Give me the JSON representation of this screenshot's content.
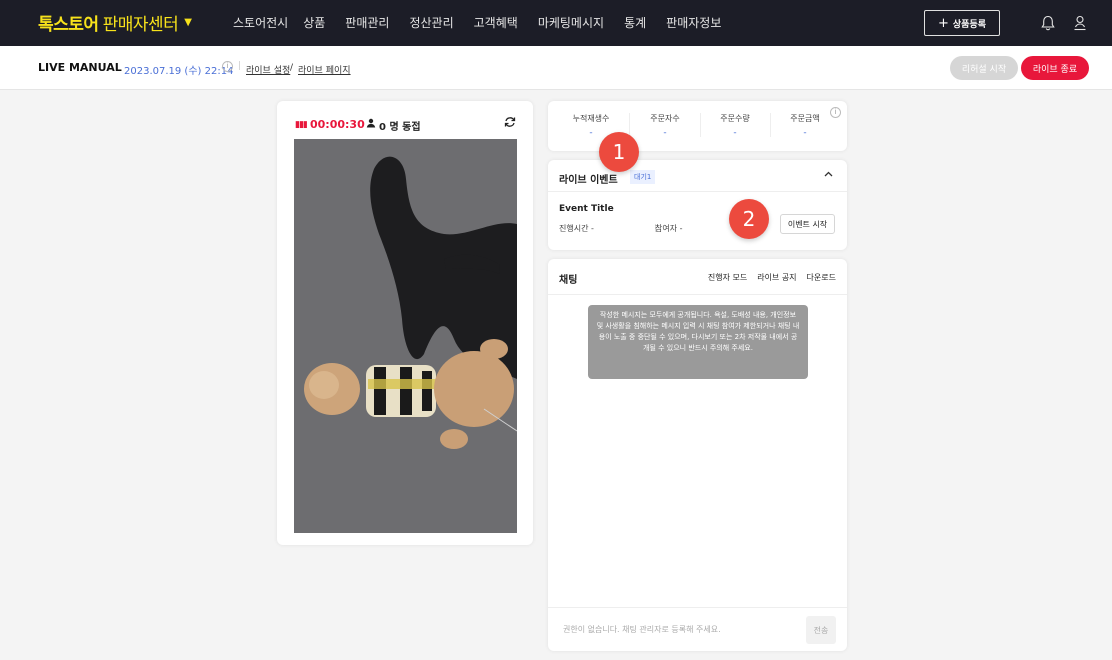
{
  "header": {
    "brand_name": "톡스토어",
    "brand_sub": "판매자센터",
    "menu": [
      "스토어전시",
      "상품",
      "판매관리",
      "정산관리",
      "고객혜택",
      "마케팅메시지",
      "통계",
      "판매자정보"
    ],
    "add_product_label": "상품등록",
    "icons": [
      "bell-icon",
      "user-icon"
    ]
  },
  "subheader": {
    "title": "LIVE MANUAL",
    "datetime": "2023.07.19 (수) 22:14",
    "link_settings": "라이브 설정",
    "link_separator": "/",
    "link_page": "라이브 페이지",
    "rehearsal_label": "리허설 시작",
    "end_label": "라이브 종료"
  },
  "video": {
    "timer": "00:00:30",
    "viewers": "0 명 동접"
  },
  "stats": [
    {
      "label": "누적재생수",
      "value": "-"
    },
    {
      "label": "주문자수",
      "value": "-"
    },
    {
      "label": "주문수량",
      "value": "-"
    },
    {
      "label": "주문금액",
      "value": "-"
    }
  ],
  "event": {
    "title": "라이브 이벤트",
    "status": "대기1",
    "name": "Event Title",
    "duration_label": "진행시간 -",
    "participants_label": "참여자 -",
    "start_label": "이벤트 시작"
  },
  "chat": {
    "title": "채팅",
    "tabs": [
      "진행자 모드",
      "라이브 공지",
      "다운로드"
    ],
    "notice": "작성한 메시지는 모두에게 공개됩니다. 욕설, 도배성 내용, 개인정보 및 사생활을 침해하는 메시지 입력 시 채팅 참여가 제한되거나 채팅 내용이 노출 중 중단될 수 있으며, 다시보기 또는 2차 저작물 내에서 공개될 수 있으니 반드시 주의해 주세요.",
    "placeholder": "권한이 없습니다. 채팅 관리자로 등록해 주세요.",
    "send_label": "전송"
  },
  "markers": [
    "1",
    "2"
  ],
  "colors": {
    "nav_bg": "#1c1d27",
    "brand": "#f7e21b",
    "live_red": "#e8173b",
    "link_blue": "#4a6fd6",
    "marker": "#ec4a3e"
  }
}
